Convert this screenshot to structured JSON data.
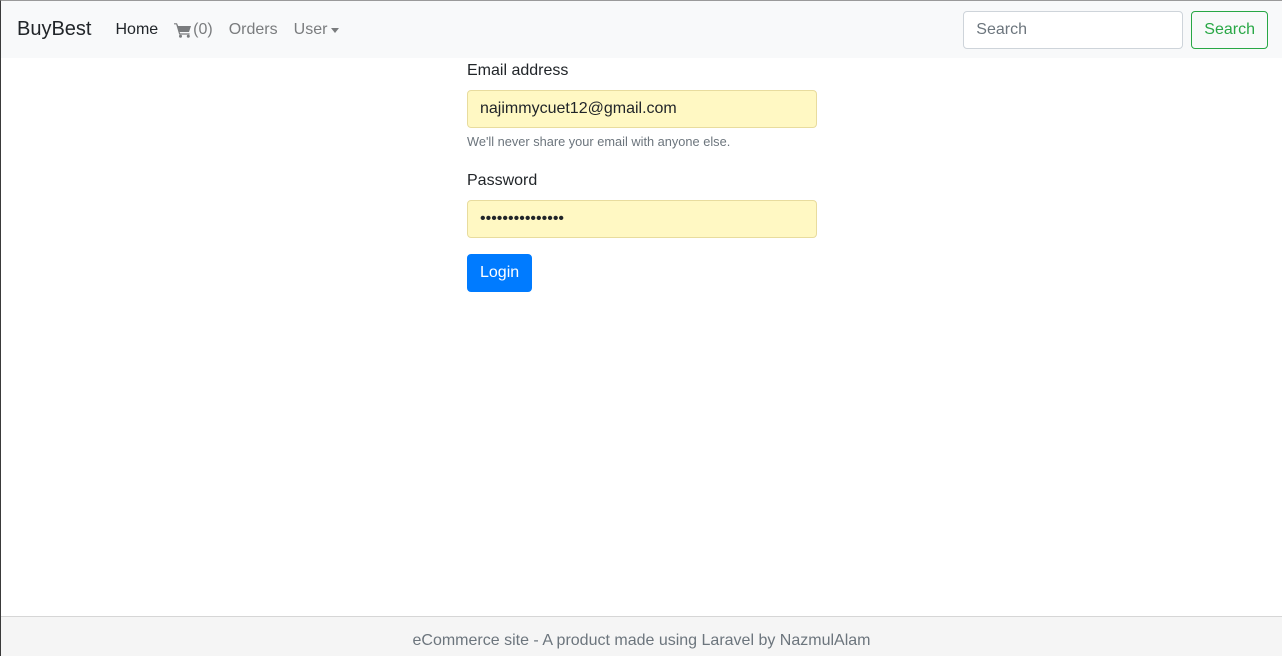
{
  "navbar": {
    "brand": "BuyBest",
    "home_label": "Home",
    "cart_count": "(0)",
    "orders_label": "Orders",
    "user_label": "User",
    "search_placeholder": "Search",
    "search_button_label": "Search"
  },
  "login": {
    "email_label": "Email address",
    "email_value": "najimmycuet12@gmail.com",
    "email_help": "We'll never share your email with anyone else.",
    "password_label": "Password",
    "password_value": "•••••••••••••••",
    "login_button_label": "Login"
  },
  "footer": {
    "text": "eCommerce site - A product made using Laravel by NazmulAlam"
  },
  "colors": {
    "navbar_bg": "#f8f9fa",
    "primary": "#007bff",
    "success": "#28a745",
    "autofill_bg": "#fff8c3",
    "footer_bg": "#f5f5f5"
  }
}
